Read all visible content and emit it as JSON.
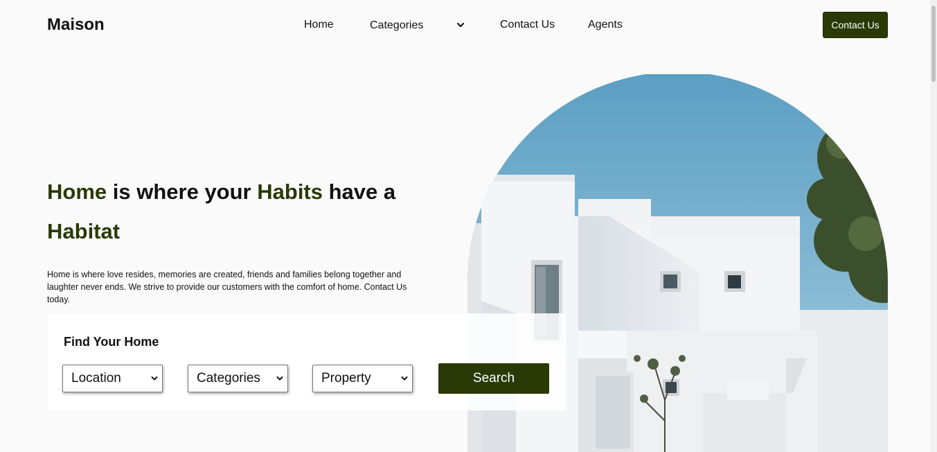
{
  "header": {
    "logo": "Maison",
    "nav": {
      "home": "Home",
      "categories": "Categories",
      "contact": "Contact Us",
      "agents": "Agents"
    },
    "cta_label": "Contact Us"
  },
  "hero": {
    "title_parts": {
      "w1": "Home",
      "w2": "is where your",
      "w3": "Habits",
      "w4": "have a",
      "w5": "Habitat"
    },
    "description": "Home is where love resides, memories are created, friends and families belong together and laughter never ends. We strive to provide our customers with the comfort of home. Contact Us today."
  },
  "search": {
    "heading": "Find Your Home",
    "location": "Location",
    "categories": "Categories",
    "property": "Property",
    "button": "Search"
  },
  "colors": {
    "accent": "#2a3a07",
    "background": "#fafafa"
  },
  "icons": {
    "dropdown": "chevron-down-icon"
  }
}
